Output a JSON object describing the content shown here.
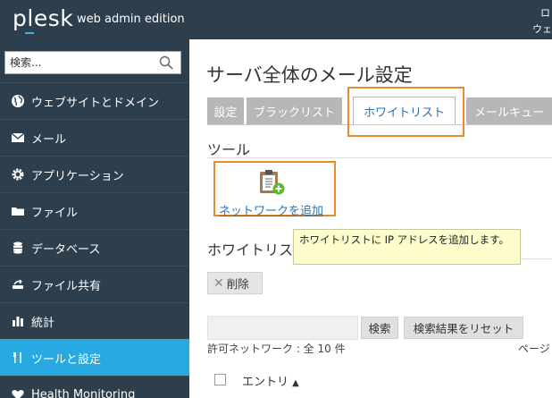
{
  "header": {
    "logo": "plesk",
    "edition": "web admin edition",
    "right_line1": "ロ",
    "right_line2": "ウェ"
  },
  "sidebar": {
    "search_placeholder": "検索...",
    "items": [
      {
        "label": "ウェブサイトとドメイン",
        "icon": "globe-icon"
      },
      {
        "label": "メール",
        "icon": "mail-icon"
      },
      {
        "label": "アプリケーション",
        "icon": "gear-icon"
      },
      {
        "label": "ファイル",
        "icon": "folder-icon"
      },
      {
        "label": "データベース",
        "icon": "database-icon"
      },
      {
        "label": "ファイル共有",
        "icon": "file-share-icon"
      },
      {
        "label": "統計",
        "icon": "bar-chart-icon"
      },
      {
        "label": "ツールと設定",
        "icon": "tools-icon",
        "active": true
      },
      {
        "label": "Health Monitoring",
        "icon": "health-icon"
      }
    ]
  },
  "main": {
    "title": "サーバ全体のメール設定",
    "tabs": [
      {
        "label": "設定"
      },
      {
        "label": "ブラックリスト"
      },
      {
        "label": "ホワイトリスト",
        "active": true
      },
      {
        "label": "メールキュー"
      }
    ],
    "tools_heading": "ツール",
    "add_network_label": "ネットワークを追加",
    "whitelist_heading": "ホワイトリスト",
    "tooltip_text": "ホワイトリストに IP アドレスを追加します。",
    "delete_label": "削除",
    "search_button": "検索",
    "reset_button": "検索結果をリセット",
    "allowed_count": "許可ネットワーク : 全 10 件",
    "page_label": "ページ",
    "column_entry": "エントリ"
  },
  "colors": {
    "sidebar_bg": "#2d3e4c",
    "active_accent": "#28a9e1",
    "highlight_orange": "#e88a2e",
    "link_blue": "#2876b5"
  }
}
